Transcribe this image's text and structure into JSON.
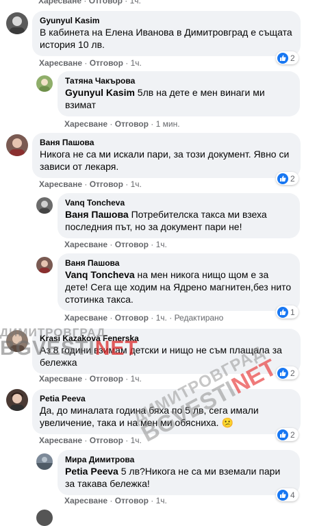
{
  "top_actions": {
    "like": "Харесване",
    "sep1": " · ",
    "reply": "Отговор",
    "sep2": " · ",
    "time": "1ч."
  },
  "comments": [
    {
      "author": "Gyunyul Kasim",
      "text": "В кабинета на Елена Иванова в Димитровград е същата история 10 лв.",
      "like": "Харесване",
      "reply": "Отговор",
      "time": "1ч.",
      "reactions": "2"
    },
    {
      "author": "Татяна Чакърова",
      "mention": "Gyunyul Kasim",
      "text": " 5лв на дете е мен винаги ми взимат",
      "like": "Харесване",
      "reply": "Отговор",
      "time": "1 мин."
    },
    {
      "author": "Ваня Пашова",
      "text": "Никога не са ми искали пари, за този документ. Явно си зависи от лекаря.",
      "like": "Харесване",
      "reply": "Отговор",
      "time": "1ч.",
      "reactions": "2"
    },
    {
      "author": "Vanq Toncheva",
      "mention": "Ваня Пашова",
      "text": " Потребителска такса ми взеха последния път, но за документ пари не!",
      "like": "Харесване",
      "reply": "Отговор",
      "time": "1ч."
    },
    {
      "author": "Ваня Пашова",
      "mention": "Vanq Toncheva",
      "text": " на мен никога нищо щом е за дете! Сега ще ходим на Ядрено магнитен,без нито стотинка такса.",
      "like": "Харесване",
      "reply": "Отговор",
      "time": "1ч.",
      "edited": "Редактирано",
      "reactions": "1"
    },
    {
      "author": "Krasi Kazakova Fenerska",
      "text": "Аз 8 години взимам детски и нищо не съм плащала за бележка",
      "like": "Харесване",
      "reply": "Отговор",
      "time": "1ч.",
      "reactions": "2"
    },
    {
      "author": "Petia Peeva",
      "text": "Да, до миналата година бяха по 5 лв, сега имали увеличение, така и на мен ми обясниха.",
      "emoji": "😕",
      "like": "Харесване",
      "reply": "Отговор",
      "time": "1ч.",
      "reactions": "2"
    },
    {
      "author": "Мира Димитрова",
      "mention": "Petia Peeva",
      "text": " 5 лв?Никога не са ми вземали пари за такава бележка!",
      "like": "Харесване",
      "reply": "Отговор",
      "time": "1ч.",
      "reactions": "4"
    }
  ],
  "watermarks": {
    "line1": "ДИМИТРОВГРАД",
    "line2a": "BGVESTI",
    "line2b": "NET"
  },
  "colors": {
    "like_blue": "#1877f2",
    "bubble": "#f0f2f5",
    "meta": "#65676b"
  }
}
